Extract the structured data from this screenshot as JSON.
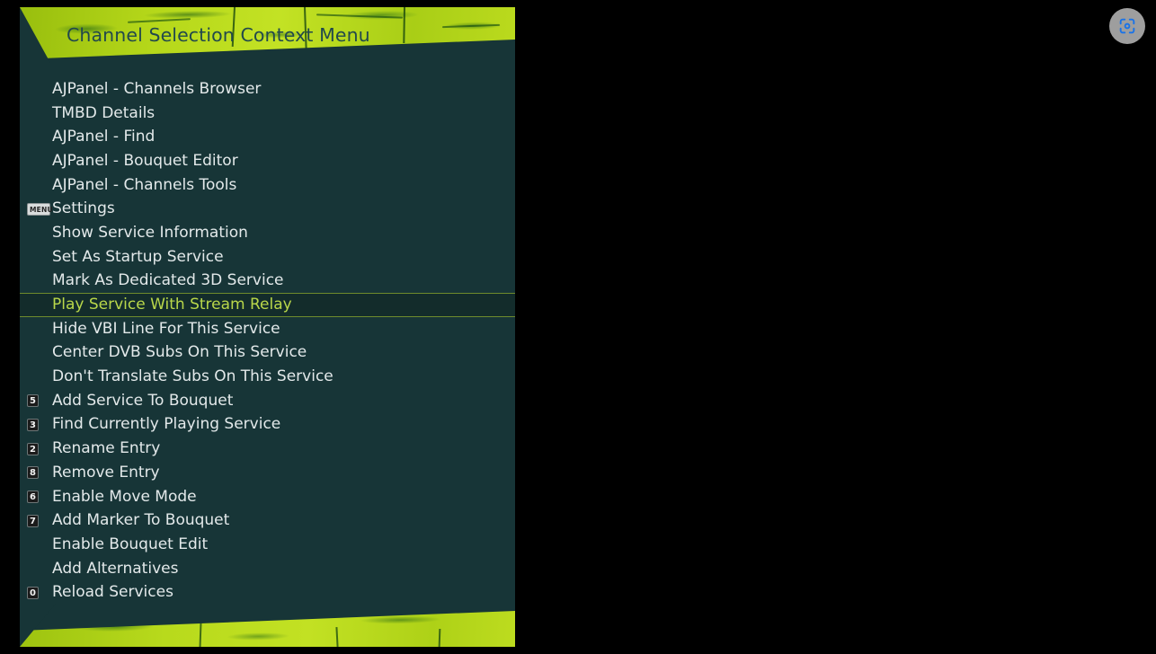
{
  "window": {
    "title": "Channel Selection Context Menu",
    "background_color": "#000000",
    "panel_color": "#173537",
    "accent_band_color": "#b6d81a",
    "title_text_color": "#22494c",
    "item_text_color": "#e3e9ea",
    "selected_text_color": "#b9d74a",
    "selected_row_color": "#132c2b",
    "selected_border_color": "#6f8b2c"
  },
  "scan_button": {
    "icon": "scan-focus-icon",
    "icon_color": "#1a73e8",
    "background_color": "#9e9e9e"
  },
  "menu": {
    "items": [
      {
        "key": "",
        "label": "AJPanel - Channels Browser",
        "selected": false
      },
      {
        "key": "",
        "label": "TMBD Details",
        "selected": false
      },
      {
        "key": "",
        "label": "AJPanel - Find",
        "selected": false
      },
      {
        "key": "",
        "label": "AJPanel - Bouquet Editor",
        "selected": false
      },
      {
        "key": "",
        "label": "AJPanel - Channels Tools",
        "selected": false
      },
      {
        "key": "MENU",
        "label": "Settings",
        "selected": false
      },
      {
        "key": "",
        "label": "Show Service Information",
        "selected": false
      },
      {
        "key": "",
        "label": "Set As Startup Service",
        "selected": false
      },
      {
        "key": "",
        "label": "Mark As Dedicated 3D Service",
        "selected": false
      },
      {
        "key": "",
        "label": "Play Service With Stream Relay",
        "selected": true
      },
      {
        "key": "",
        "label": "Hide VBI Line For This Service",
        "selected": false
      },
      {
        "key": "",
        "label": "Center DVB Subs On This Service",
        "selected": false
      },
      {
        "key": "",
        "label": "Don't Translate Subs On This Service",
        "selected": false
      },
      {
        "key": "5",
        "label": "Add Service To Bouquet",
        "selected": false
      },
      {
        "key": "3",
        "label": "Find Currently Playing Service",
        "selected": false
      },
      {
        "key": "2",
        "label": "Rename Entry",
        "selected": false
      },
      {
        "key": "8",
        "label": "Remove Entry",
        "selected": false
      },
      {
        "key": "6",
        "label": "Enable Move Mode",
        "selected": false
      },
      {
        "key": "7",
        "label": "Add Marker To Bouquet",
        "selected": false
      },
      {
        "key": "",
        "label": "Enable Bouquet Edit",
        "selected": false
      },
      {
        "key": "",
        "label": "Add Alternatives",
        "selected": false
      },
      {
        "key": "0",
        "label": "Reload Services",
        "selected": false
      }
    ]
  }
}
